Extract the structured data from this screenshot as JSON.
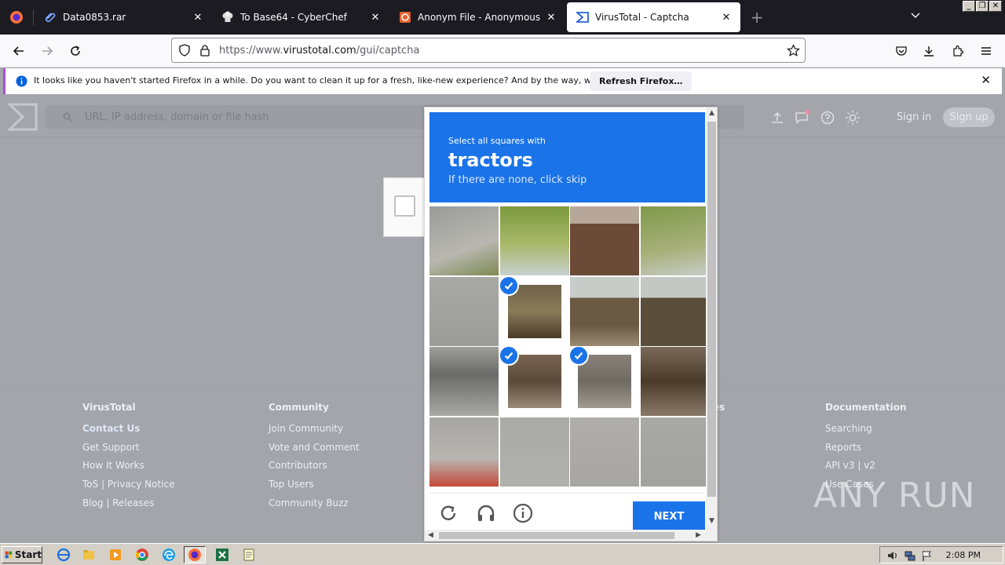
{
  "browser": {
    "tabs": [
      {
        "title": "Data0853.rar",
        "active": false
      },
      {
        "title": "To Base64 - CyberChef",
        "active": false
      },
      {
        "title": "Anonym File - Anonymous File Uplo",
        "active": false
      },
      {
        "title": "VirusTotal - Captcha",
        "active": true
      }
    ],
    "url_prefix": "https://www.",
    "url_domain": "virustotal.com",
    "url_path": "/gui/captcha"
  },
  "notification": {
    "text": "It looks like you haven't started Firefox in a while. Do you want to clean it up for a fresh, like-new experience? And by the way, welcome back!",
    "button": "Refresh Firefox…"
  },
  "virustotal": {
    "search_placeholder": "URL, IP address, domain or file hash",
    "sign_in": "Sign in",
    "sign_up": "Sign up"
  },
  "footer": {
    "columns": [
      {
        "heading": "VirusTotal",
        "links": [
          "Contact Us",
          "Get Support",
          "How It Works",
          "ToS | Privacy Notice",
          "Blog | Releases"
        ]
      },
      {
        "heading": "Community",
        "links": [
          "Join Community",
          "Vote and Comment",
          "Contributors",
          "Top Users",
          "Community Buzz"
        ]
      },
      {
        "heading": "es",
        "links": []
      },
      {
        "heading": "Documentation",
        "links": [
          "Searching",
          "Reports",
          "API v3 | v2",
          "Use Cases"
        ]
      }
    ]
  },
  "captcha": {
    "prompt": "Select all squares with",
    "target": "tractors",
    "hint": "If there are none, click skip",
    "next": "NEXT",
    "selected_tiles": [
      5,
      9,
      10
    ],
    "accent_color": "#1a73e8"
  },
  "watermark": "ANY RUN",
  "taskbar": {
    "start": "Start",
    "clock": "2:08 PM"
  }
}
